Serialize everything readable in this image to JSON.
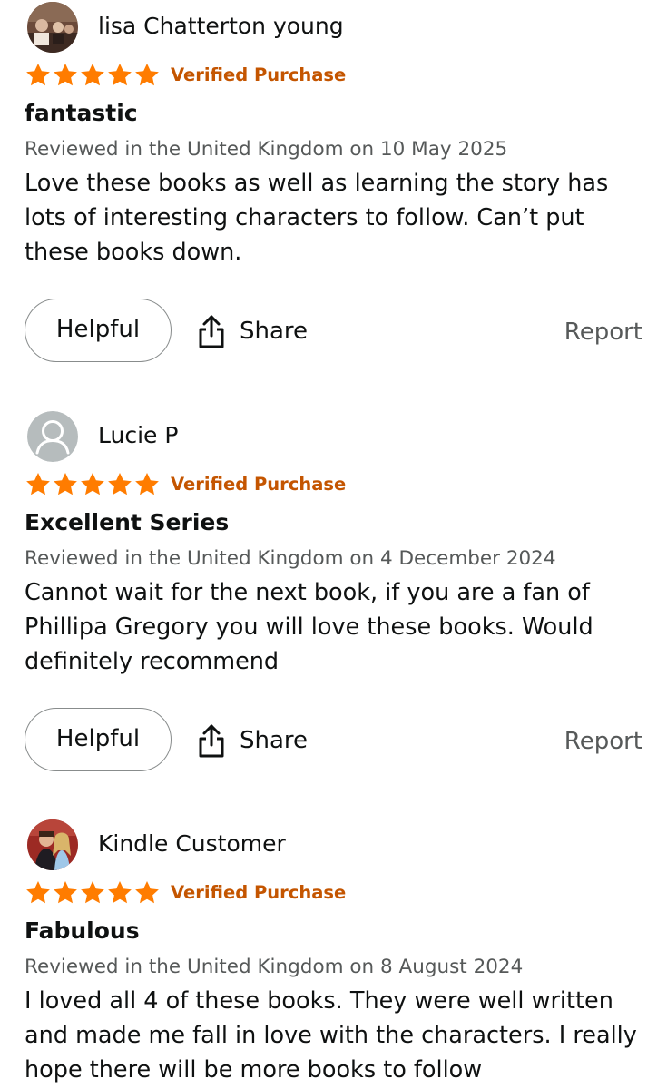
{
  "colors": {
    "star": "#ff7c00",
    "verified": "#c45500",
    "muted": "#565959",
    "text": "#0f1111",
    "button_border": "#888c8c"
  },
  "reviews": [
    {
      "reviewer": "lisa Chatterton young",
      "avatar": "profile-photo",
      "rating": 5,
      "verified": "Verified Purchase",
      "title": "fantastic",
      "date": "Reviewed in the United Kingdom on 10 May 2025",
      "body_lines": [
        "Love these books as well as learning the story has",
        "lots of interesting characters to follow. Can’t put",
        "these books down."
      ],
      "helpful_label": "Helpful",
      "share_label": "Share",
      "report_label": "Report"
    },
    {
      "reviewer": "Lucie P",
      "avatar": "default-user-icon",
      "rating": 5,
      "verified": "Verified Purchase",
      "title": "Excellent Series",
      "date": "Reviewed in the United Kingdom on 4 December 2024",
      "body_lines": [
        "Cannot wait for the next book, if you are a fan of",
        "Phillipa Gregory you will love these books. Would",
        "definitely recommend"
      ],
      "helpful_label": "Helpful",
      "share_label": "Share",
      "report_label": "Report"
    },
    {
      "reviewer": "Kindle Customer",
      "avatar": "profile-photo",
      "rating": 5,
      "verified": "Verified Purchase",
      "title": "Fabulous",
      "date": "Reviewed in the United Kingdom on 8 August 2024",
      "body_lines": [
        "I loved all 4 of these books. They were well written",
        "and made me fall in love with the characters. I really",
        "hope there will be more books to follow"
      ]
    }
  ]
}
